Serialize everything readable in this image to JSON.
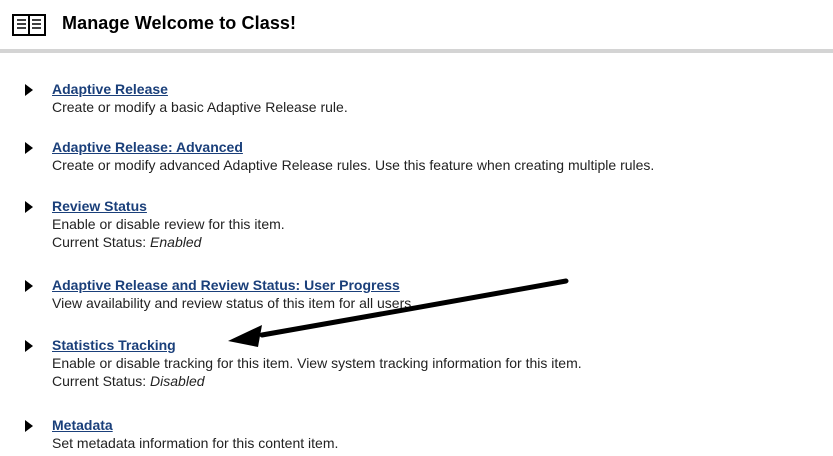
{
  "header": {
    "title": "Manage Welcome to Class!",
    "icon": "book-icon"
  },
  "items": [
    {
      "link": "Adaptive Release",
      "description": "Create or modify a basic Adaptive Release rule."
    },
    {
      "link": "Adaptive Release: Advanced",
      "description": "Create or modify advanced Adaptive Release rules. Use this feature when creating multiple rules."
    },
    {
      "link": "Review Status",
      "description": "Enable or disable review for this item.",
      "status_label": "Current Status:",
      "status_value": "Enabled"
    },
    {
      "link": "Adaptive Release and Review Status: User Progress",
      "description": "View availability and review status of this item for all users."
    },
    {
      "link": "Statistics Tracking",
      "description": "Enable or disable tracking for this item. View system tracking information for this item.",
      "status_label": "Current Status:",
      "status_value": "Disabled"
    },
    {
      "link": "Metadata",
      "description": "Set metadata information for this content item."
    }
  ],
  "colors": {
    "link": "#1a3f7a",
    "divider": "#d4d4d4"
  }
}
